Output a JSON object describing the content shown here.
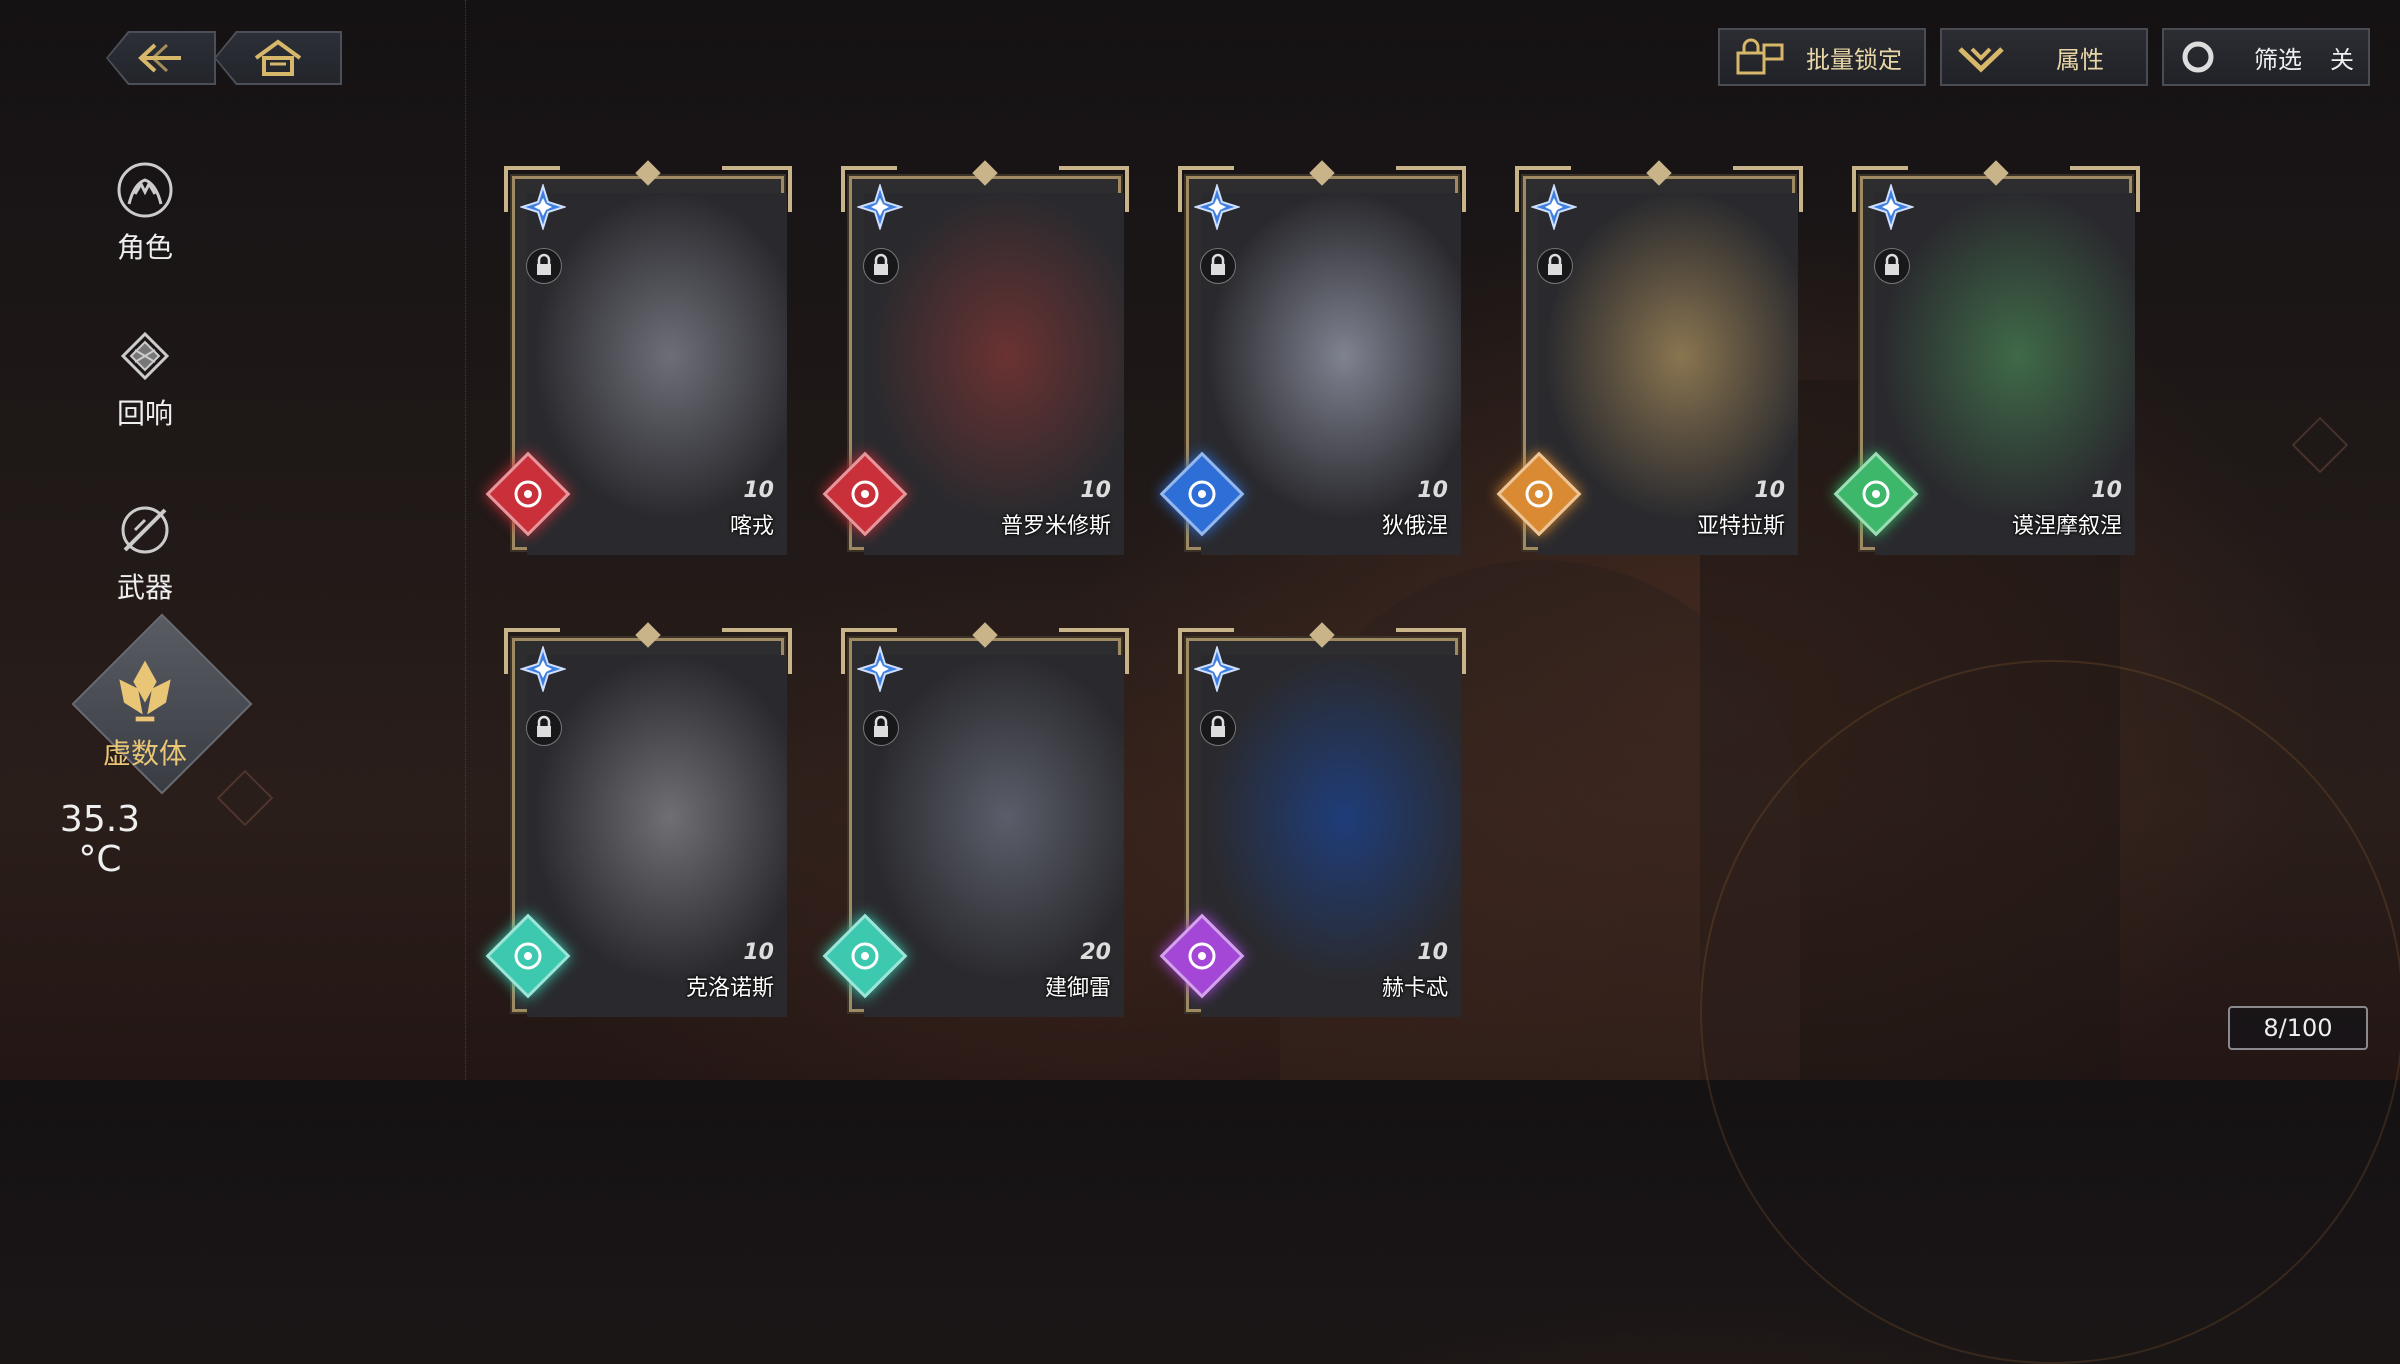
{
  "top_left": {
    "back": "back-arrow-icon",
    "home": "home-icon"
  },
  "top_right": {
    "batch_lock": "批量锁定",
    "attribute": "属性",
    "filter_label": "筛选",
    "filter_state": "关"
  },
  "sidebar": {
    "items": [
      {
        "label": "角色",
        "icon": "character-icon"
      },
      {
        "label": "回响",
        "icon": "echo-icon"
      },
      {
        "label": "武器",
        "icon": "weapon-icon"
      },
      {
        "label": "虚数体",
        "icon": "imaginary-icon",
        "active": true
      }
    ]
  },
  "temperature": {
    "value": "35.3",
    "unit": "°C"
  },
  "cards": [
    {
      "name": "喀戎",
      "level": "10",
      "element": "fire",
      "elem_color": "#c9303a"
    },
    {
      "name": "普罗米修斯",
      "level": "10",
      "element": "fire",
      "elem_color": "#c9303a"
    },
    {
      "name": "狄俄涅",
      "level": "10",
      "element": "water",
      "elem_color": "#2d6fd6"
    },
    {
      "name": "亚特拉斯",
      "level": "10",
      "element": "earth",
      "elem_color": "#d98a32"
    },
    {
      "name": "谟涅摩叙涅",
      "level": "10",
      "element": "wind",
      "elem_color": "#3db86a"
    },
    {
      "name": "克洛诺斯",
      "level": "10",
      "element": "light",
      "elem_color": "#3cc9b0"
    },
    {
      "name": "建御雷",
      "level": "20",
      "element": "light",
      "elem_color": "#3cc9b0"
    },
    {
      "name": "赫卡忒",
      "level": "10",
      "element": "dark",
      "elem_color": "#a447d6"
    }
  ],
  "page_count": "8/100",
  "colors": {
    "gold": "#c9b48a",
    "accent_text": "#e8d6a6",
    "active_nav": "#e9c676"
  }
}
